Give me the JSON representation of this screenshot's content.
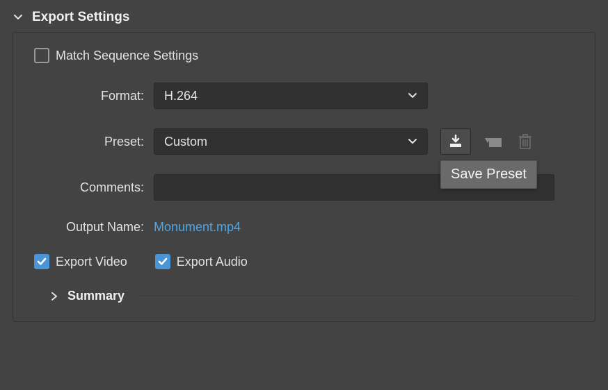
{
  "section": {
    "title": "Export Settings",
    "match_sequence_label": "Match Sequence Settings",
    "match_sequence_checked": false
  },
  "format": {
    "label": "Format:",
    "value": "H.264"
  },
  "preset": {
    "label": "Preset:",
    "value": "Custom",
    "save_tooltip": "Save Preset"
  },
  "comments": {
    "label": "Comments:",
    "value": ""
  },
  "output": {
    "label": "Output Name:",
    "filename": "Monument.mp4"
  },
  "export_video": {
    "label": "Export Video",
    "checked": true
  },
  "export_audio": {
    "label": "Export Audio",
    "checked": true
  },
  "summary": {
    "title": "Summary"
  },
  "icons": {
    "save_preset": "save-preset-icon",
    "import_preset": "import-preset-icon",
    "delete_preset": "trash-icon"
  }
}
